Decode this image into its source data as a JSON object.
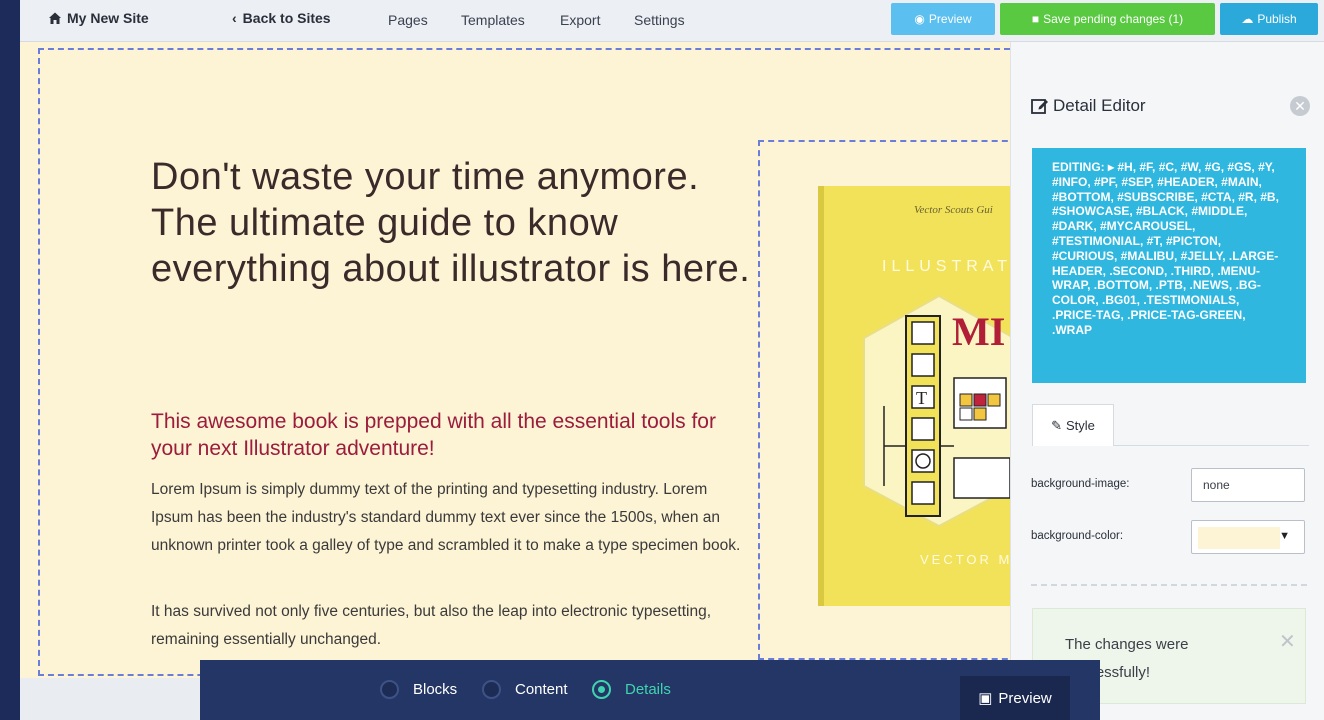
{
  "topbar": {
    "site_name": "My New Site",
    "back_label": "Back to Sites",
    "nav": [
      "Pages",
      "Templates",
      "Export",
      "Settings"
    ],
    "preview_label": "Preview",
    "save_label": "Save pending changes (1)",
    "publish_label": "Publish"
  },
  "canvas": {
    "headline": "Don't waste your time anymore. The ultimate guide to know everything about illustrator is here.",
    "subhead": "This awesome book is prepped with all the essential tools for your next Illustrator adventure!",
    "para1": "Lorem Ipsum is simply dummy text of the printing and typesetting industry. Lorem Ipsum has been the industry's standard dummy text ever since the 1500s, when an unknown printer took a galley of type and scrambled it to make a type specimen book.",
    "para2": "It has survived not only five centuries, but also the leap into electronic typesetting, remaining essentially unchanged.",
    "book": {
      "series": "Vector Scouts Gui",
      "cover_word": "ILLUSTRAT",
      "cover_mark": "MI",
      "footer": "VECTOR MIL"
    }
  },
  "panel": {
    "title": "Detail Editor",
    "editing": "EDITING: ▸ #H, #F, #C, #W, #G, #GS, #Y, #INFO, #PF, #SEP, #HEADER, #MAIN, #BOTTOM, #SUBSCRIBE, #CTA, #R, #B, #SHOWCASE, #BLACK, #MIDDLE, #DARK, #MYCAROUSEL, #TESTIMONIAL, #T, #PICTON, #CURIOUS, #MALIBU, #JELLY, .LARGE-HEADER, .SECOND, .THIRD, .MENU-WRAP, .BOTTOM, .PTB, .NEWS, .BG-COLOR, .BG01, .TESTIMONIALS, .PRICE-TAG, .PRICE-TAG-GREEN, .WRAP",
    "tab_style": "Style",
    "bg_image_label": "background-image:",
    "bg_image_value": "none",
    "bg_color_label": "background-color:",
    "bg_color_value": "#fdf3d5",
    "alert": "The changes were successfully!"
  },
  "bottombar": {
    "blocks": "Blocks",
    "content": "Content",
    "details": "Details",
    "preview": "Preview"
  },
  "colors": {
    "rail": "#1c2b5a",
    "canvas_bg": "#fdf3d5",
    "headline": "#3b2a2a",
    "subhead": "#9b1c3c",
    "editing_bg": "#2fb7e0",
    "save_green": "#58c940",
    "accent_teal": "#40d3b0"
  }
}
